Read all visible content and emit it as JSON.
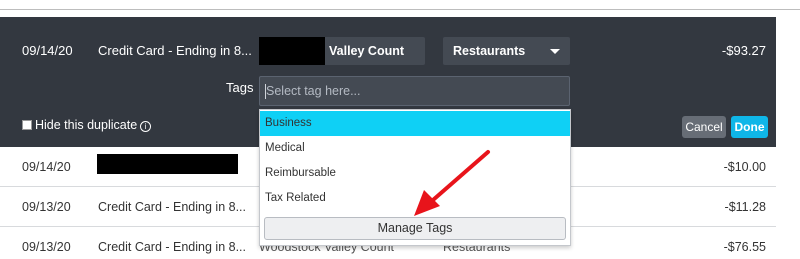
{
  "edit_row": {
    "date": "09/14/20",
    "account": "Credit Card - Ending in 8...",
    "merchant": "Valley Count",
    "category": "Restaurants",
    "amount": "-$93.27",
    "tags_label": "Tags",
    "tag_placeholder": "Select tag here...",
    "hide_duplicate_label": "Hide this duplicate",
    "info_glyph": "i",
    "cancel_label": "Cancel",
    "done_label": "Done"
  },
  "tag_dropdown": {
    "options": [
      "Business",
      "Medical",
      "Reimbursable",
      "Tax Related"
    ],
    "highlighted": "Business",
    "manage_label": "Manage Tags"
  },
  "rows": [
    {
      "date": "09/14/20",
      "account": "",
      "merchant": "",
      "category": "",
      "amount": "-$10.00"
    },
    {
      "date": "09/13/20",
      "account": "Credit Card - Ending in 8...",
      "merchant": "",
      "category": "",
      "amount": "-$11.28"
    },
    {
      "date": "09/13/20",
      "account": "Credit Card - Ending in 8...",
      "merchant": "Woodstock Valley Count",
      "category": "Restaurants",
      "amount": "-$76.55"
    }
  ],
  "colors": {
    "panel_bg": "#333840",
    "accent": "#0fb6e8",
    "highlight": "#0fd0f5",
    "annotation_arrow": "#e8141b"
  }
}
